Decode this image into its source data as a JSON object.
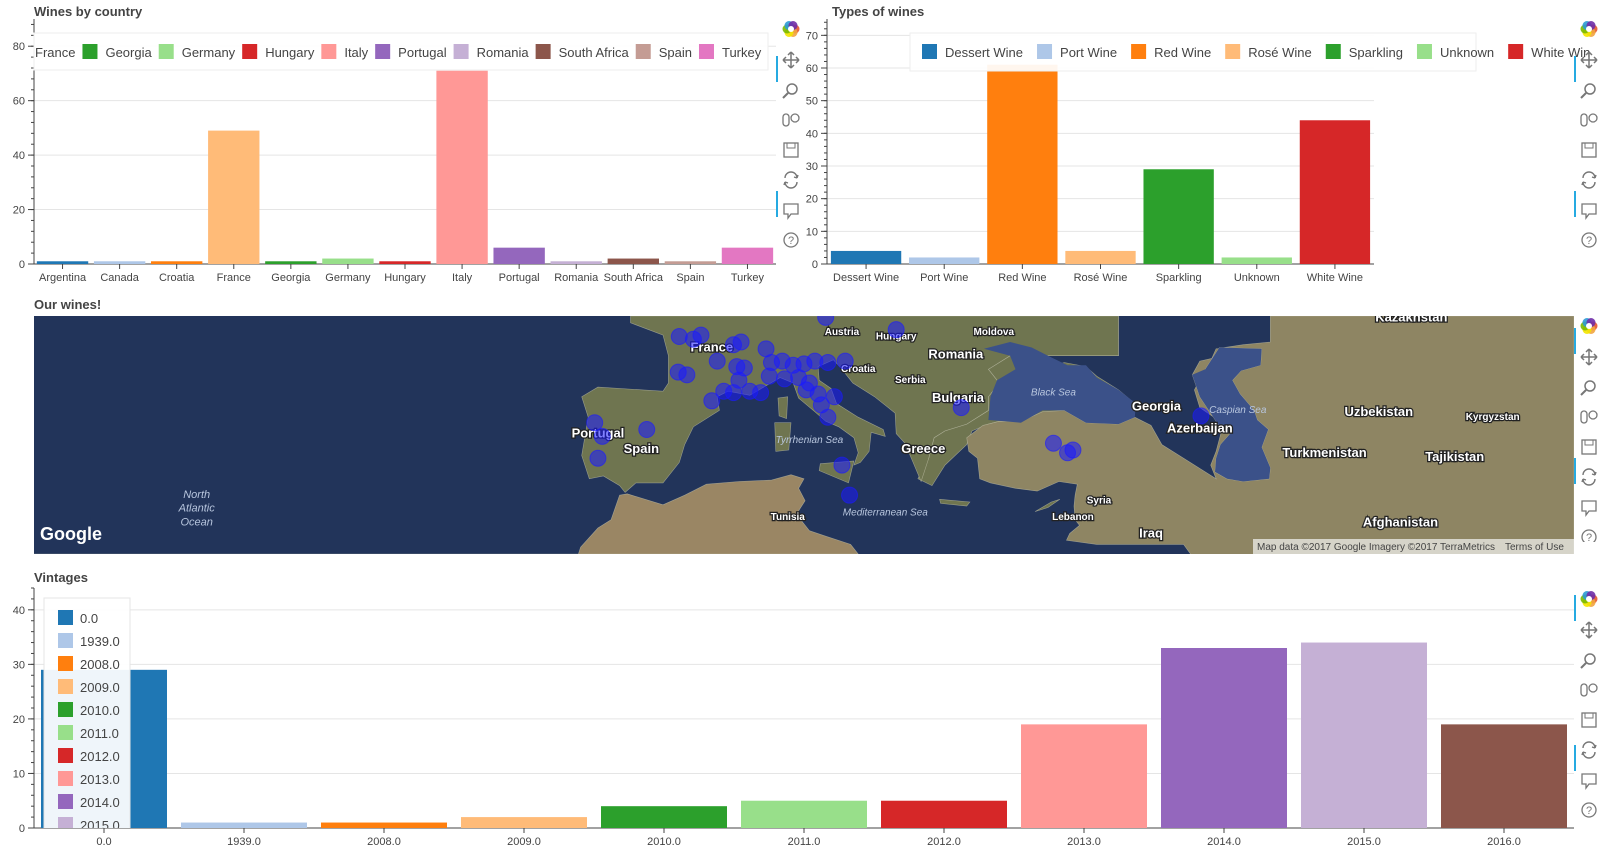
{
  "panels": {
    "countries": {
      "title": "Wines by country"
    },
    "types": {
      "title": "Types of wines"
    },
    "map": {
      "title": "Our wines!"
    },
    "vintages": {
      "title": "Vintages"
    }
  },
  "chart_data": [
    {
      "type": "bar",
      "title": "Wines by country",
      "categories": [
        "Argentina",
        "Canada",
        "Croatia",
        "France",
        "Georgia",
        "Germany",
        "Hungary",
        "Italy",
        "Portugal",
        "Romania",
        "South Africa",
        "Spain",
        "Turkey"
      ],
      "values": [
        1,
        1,
        1,
        49,
        1,
        2,
        1,
        71,
        6,
        1,
        2,
        1,
        6
      ],
      "colors": [
        "#1f77b4",
        "#aec7e8",
        "#ff7f0e",
        "#ffbb78",
        "#2ca02c",
        "#98df8a",
        "#d62728",
        "#ff9896",
        "#9467bd",
        "#c5b0d5",
        "#8c564b",
        "#c49c94",
        "#e377c2"
      ],
      "legend_labels": [
        "France",
        "Georgia",
        "Germany",
        "Hungary",
        "Italy",
        "Portugal",
        "Romania",
        "South Africa",
        "Spain",
        "Turkey"
      ],
      "legend_colors": [
        "#ffbb78",
        "#2ca02c",
        "#98df8a",
        "#d62728",
        "#ff9896",
        "#9467bd",
        "#c5b0d5",
        "#8c564b",
        "#c49c94",
        "#e377c2"
      ],
      "legend_placement": "top",
      "ylim": [
        0,
        90
      ],
      "yticks": [
        "0",
        "20",
        "40",
        "60",
        "80"
      ]
    },
    {
      "type": "bar",
      "title": "Types of wines",
      "categories": [
        "Dessert Wine",
        "Port Wine",
        "Red Wine",
        "Rosé Wine",
        "Sparkling",
        "Unknown",
        "White Wine"
      ],
      "values": [
        4,
        2,
        61,
        4,
        29,
        2,
        44
      ],
      "colors": [
        "#1f77b4",
        "#aec7e8",
        "#ff7f0e",
        "#ffbb78",
        "#2ca02c",
        "#98df8a",
        "#d62728"
      ],
      "legend_placement": "top-right",
      "ylim": [
        0,
        75
      ],
      "yticks": [
        "0",
        "10",
        "20",
        "30",
        "40",
        "50",
        "60",
        "70"
      ]
    },
    {
      "type": "bar",
      "title": "Vintages",
      "categories": [
        "0.0",
        "1939.0",
        "2008.0",
        "2009.0",
        "2010.0",
        "2011.0",
        "2012.0",
        "2013.0",
        "2014.0",
        "2015.0",
        "2016.0"
      ],
      "values": [
        29,
        1,
        1,
        2,
        4,
        5,
        5,
        19,
        33,
        34,
        19
      ],
      "colors": [
        "#1f77b4",
        "#aec7e8",
        "#ff7f0e",
        "#ffbb78",
        "#2ca02c",
        "#98df8a",
        "#d62728",
        "#ff9896",
        "#9467bd",
        "#c5b0d5",
        "#8c564b"
      ],
      "legend_placement": "top-left",
      "ylim": [
        0,
        44
      ],
      "yticks": [
        "0",
        "10",
        "20",
        "30",
        "40"
      ]
    }
  ],
  "map": {
    "labels": [
      {
        "text": "Austria",
        "lon": 14.5,
        "lat": 47.5,
        "size": 10
      },
      {
        "text": "Hungary",
        "lon": 19.5,
        "lat": 47.2,
        "size": 10
      },
      {
        "text": "Moldova",
        "lon": 28.5,
        "lat": 47.5,
        "size": 10
      },
      {
        "text": "Kazakhstan",
        "lon": 67,
        "lat": 48.5,
        "size": 13
      },
      {
        "text": "France",
        "lon": 2.5,
        "lat": 46.3,
        "size": 13
      },
      {
        "text": "Croatia",
        "lon": 16,
        "lat": 44.8,
        "size": 10
      },
      {
        "text": "Romania",
        "lon": 25,
        "lat": 45.8,
        "size": 13
      },
      {
        "text": "Serbia",
        "lon": 20.8,
        "lat": 44,
        "size": 10
      },
      {
        "text": "Black Sea",
        "lon": 34,
        "lat": 43.1,
        "size": 10,
        "italic": true
      },
      {
        "text": "Georgia",
        "lon": 43.5,
        "lat": 42,
        "size": 13
      },
      {
        "text": "Caspian Sea",
        "lon": 51,
        "lat": 41.8,
        "size": 10,
        "italic": true
      },
      {
        "text": "Uzbekistan",
        "lon": 64,
        "lat": 41.6,
        "size": 13
      },
      {
        "text": "Kyrgyzstan",
        "lon": 74.5,
        "lat": 41.3,
        "size": 10
      },
      {
        "text": "Bulgaria",
        "lon": 25.2,
        "lat": 42.6,
        "size": 13
      },
      {
        "text": "Portugal",
        "lon": -8,
        "lat": 40,
        "size": 13
      },
      {
        "text": "Azerbaijan",
        "lon": 47.5,
        "lat": 40.4,
        "size": 13
      },
      {
        "text": "Spain",
        "lon": -4,
        "lat": 38.9,
        "size": 13
      },
      {
        "text": "Tyrrhenian Sea",
        "lon": 11.5,
        "lat": 39.6,
        "size": 10,
        "italic": true
      },
      {
        "text": "Greece",
        "lon": 22,
        "lat": 38.9,
        "size": 13
      },
      {
        "text": "Turkmenistan",
        "lon": 59,
        "lat": 38.6,
        "size": 13
      },
      {
        "text": "Tajikistan",
        "lon": 71,
        "lat": 38.3,
        "size": 13
      },
      {
        "text": "North",
        "lon": -45,
        "lat": 35.6,
        "size": 11,
        "italic": true
      },
      {
        "text": "Atlantic",
        "lon": -45,
        "lat": 34.6,
        "size": 11,
        "italic": true
      },
      {
        "text": "Ocean",
        "lon": -45,
        "lat": 33.6,
        "size": 11,
        "italic": true
      },
      {
        "text": "Syria",
        "lon": 38.2,
        "lat": 35.2,
        "size": 10
      },
      {
        "text": "Tunisia",
        "lon": 9.5,
        "lat": 34,
        "size": 10
      },
      {
        "text": "Mediterranean Sea",
        "lon": 18.5,
        "lat": 34.3,
        "size": 10,
        "italic": true
      },
      {
        "text": "Lebanon",
        "lon": 35.8,
        "lat": 34,
        "size": 10
      },
      {
        "text": "Afghanistan",
        "lon": 66,
        "lat": 33.5,
        "size": 13
      },
      {
        "text": "Iraq",
        "lon": 43,
        "lat": 32.7,
        "size": 13
      }
    ],
    "points": [
      {
        "lon": 13,
        "lat": 48.8
      },
      {
        "lon": -0.5,
        "lat": 47.4
      },
      {
        "lon": 0.8,
        "lat": 47.2
      },
      {
        "lon": 1.5,
        "lat": 47.5
      },
      {
        "lon": 4.5,
        "lat": 46.8
      },
      {
        "lon": 5.2,
        "lat": 47
      },
      {
        "lon": 7.5,
        "lat": 46.5
      },
      {
        "lon": 19.5,
        "lat": 47.9
      },
      {
        "lon": 3,
        "lat": 45.6
      },
      {
        "lon": 4.8,
        "lat": 45.2
      },
      {
        "lon": 5.5,
        "lat": 45.1
      },
      {
        "lon": 8,
        "lat": 45.5
      },
      {
        "lon": 9,
        "lat": 45.6
      },
      {
        "lon": 10,
        "lat": 45.3
      },
      {
        "lon": 11,
        "lat": 45.4
      },
      {
        "lon": 12,
        "lat": 45.6
      },
      {
        "lon": 13.2,
        "lat": 45.5
      },
      {
        "lon": 14.8,
        "lat": 45.6
      },
      {
        "lon": -0.6,
        "lat": 44.8
      },
      {
        "lon": 0.2,
        "lat": 44.6
      },
      {
        "lon": 5,
        "lat": 44.2
      },
      {
        "lon": 7.8,
        "lat": 44.5
      },
      {
        "lon": 9.2,
        "lat": 44.3
      },
      {
        "lon": 10.5,
        "lat": 44.4
      },
      {
        "lon": 11.5,
        "lat": 44
      },
      {
        "lon": 12.3,
        "lat": 43.2
      },
      {
        "lon": 3.6,
        "lat": 43.4
      },
      {
        "lon": 4.5,
        "lat": 43.3
      },
      {
        "lon": 6,
        "lat": 43.4
      },
      {
        "lon": 7,
        "lat": 43.3
      },
      {
        "lon": 11.2,
        "lat": 43.5
      },
      {
        "lon": 13.8,
        "lat": 43
      },
      {
        "lon": 12.6,
        "lat": 42.4
      },
      {
        "lon": 2.5,
        "lat": 42.7
      },
      {
        "lon": 13.2,
        "lat": 41.5
      },
      {
        "lon": -8.3,
        "lat": 41.1
      },
      {
        "lon": -7.6,
        "lat": 40.1
      },
      {
        "lon": -3.5,
        "lat": 40.6
      },
      {
        "lon": -8,
        "lat": 38.5
      },
      {
        "lon": 14.5,
        "lat": 38
      },
      {
        "lon": 15.2,
        "lat": 35.8
      },
      {
        "lon": 25.5,
        "lat": 42.2
      },
      {
        "lon": 34,
        "lat": 39.6
      },
      {
        "lon": 35.8,
        "lat": 39.1
      },
      {
        "lon": 35.3,
        "lat": 38.9
      },
      {
        "lon": 47.6,
        "lat": 41.6
      }
    ],
    "google_label": "Google",
    "attribution": "Map data ©2017 Google Imagery ©2017 TerraMetrics",
    "terms_label": "Terms of Use"
  },
  "toolbar": {
    "tool_names": [
      "bokeh-logo-icon",
      "pan-icon",
      "zoom-icon",
      "wheel-zoom-icon",
      "save-icon",
      "reset-icon",
      "hover-icon",
      "help-icon"
    ]
  }
}
